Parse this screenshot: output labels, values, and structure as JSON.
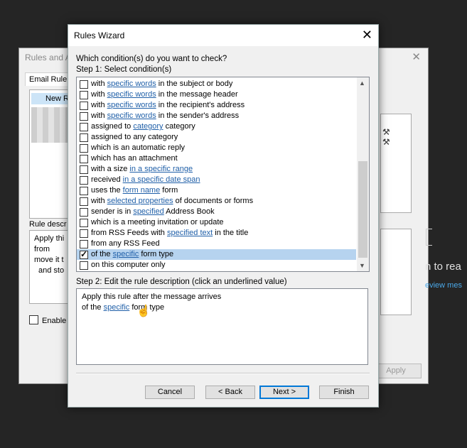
{
  "background_dialog": {
    "title": "Rules and A",
    "close_glyph": "✕",
    "tab": "Email Rule",
    "new_rule": "New R",
    "desc_label": "Rule descr",
    "desc_lines": [
      "Apply thi",
      "from",
      "move it t",
      "and sto"
    ],
    "enable_label": "Enable",
    "apply_label": "Apply",
    "tool_glyphs": "⚒\n⚒"
  },
  "outside": {
    "partial_text": "n to rea",
    "partial_link": "eview mes"
  },
  "wizard": {
    "title": "Rules Wizard",
    "close_glyph": "✕",
    "question": "Which condition(s) do you want to check?",
    "step1": "Step 1: Select condition(s)",
    "conditions": [
      {
        "checked": false,
        "selected": false,
        "parts": [
          {
            "t": "with "
          },
          {
            "t": "specific words",
            "link": true
          },
          {
            "t": " in the subject or body"
          }
        ]
      },
      {
        "checked": false,
        "selected": false,
        "parts": [
          {
            "t": "with "
          },
          {
            "t": "specific words",
            "link": true
          },
          {
            "t": " in the message header"
          }
        ]
      },
      {
        "checked": false,
        "selected": false,
        "parts": [
          {
            "t": "with "
          },
          {
            "t": "specific words",
            "link": true
          },
          {
            "t": " in the recipient's address"
          }
        ]
      },
      {
        "checked": false,
        "selected": false,
        "parts": [
          {
            "t": "with "
          },
          {
            "t": "specific words",
            "link": true
          },
          {
            "t": " in the sender's address"
          }
        ]
      },
      {
        "checked": false,
        "selected": false,
        "parts": [
          {
            "t": "assigned to "
          },
          {
            "t": "category",
            "link": true
          },
          {
            "t": " category"
          }
        ]
      },
      {
        "checked": false,
        "selected": false,
        "parts": [
          {
            "t": "assigned to any category"
          }
        ]
      },
      {
        "checked": false,
        "selected": false,
        "parts": [
          {
            "t": "which is an automatic reply"
          }
        ]
      },
      {
        "checked": false,
        "selected": false,
        "parts": [
          {
            "t": "which has an attachment"
          }
        ]
      },
      {
        "checked": false,
        "selected": false,
        "parts": [
          {
            "t": "with a size "
          },
          {
            "t": "in a specific range",
            "link": true
          }
        ]
      },
      {
        "checked": false,
        "selected": false,
        "parts": [
          {
            "t": "received "
          },
          {
            "t": "in a specific date span",
            "link": true
          }
        ]
      },
      {
        "checked": false,
        "selected": false,
        "parts": [
          {
            "t": "uses the "
          },
          {
            "t": "form name",
            "link": true
          },
          {
            "t": " form"
          }
        ]
      },
      {
        "checked": false,
        "selected": false,
        "parts": [
          {
            "t": "with "
          },
          {
            "t": "selected properties",
            "link": true
          },
          {
            "t": " of documents or forms"
          }
        ]
      },
      {
        "checked": false,
        "selected": false,
        "parts": [
          {
            "t": "sender is in "
          },
          {
            "t": "specified",
            "link": true
          },
          {
            "t": " Address Book"
          }
        ]
      },
      {
        "checked": false,
        "selected": false,
        "parts": [
          {
            "t": "which is a meeting invitation or update"
          }
        ]
      },
      {
        "checked": false,
        "selected": false,
        "parts": [
          {
            "t": "from RSS Feeds with "
          },
          {
            "t": "specified text",
            "link": true
          },
          {
            "t": " in the title"
          }
        ]
      },
      {
        "checked": false,
        "selected": false,
        "parts": [
          {
            "t": "from any RSS Feed"
          }
        ]
      },
      {
        "checked": true,
        "selected": true,
        "parts": [
          {
            "t": "of the "
          },
          {
            "t": "specific",
            "link": true
          },
          {
            "t": " form type"
          }
        ]
      },
      {
        "checked": false,
        "selected": false,
        "parts": [
          {
            "t": "on this computer only"
          }
        ]
      }
    ],
    "step2": "Step 2: Edit the rule description (click an underlined value)",
    "description": {
      "line1": "Apply this rule after the message arrives",
      "line2_prefix": "of the ",
      "line2_link": "specific",
      "line2_suffix": " form type"
    },
    "buttons": {
      "cancel": "Cancel",
      "back": "< Back",
      "next": "Next >",
      "finish": "Finish"
    }
  },
  "colors": {
    "link": "#1f5fa8",
    "selection": "#b6d3ef",
    "desktop": "#252525"
  }
}
